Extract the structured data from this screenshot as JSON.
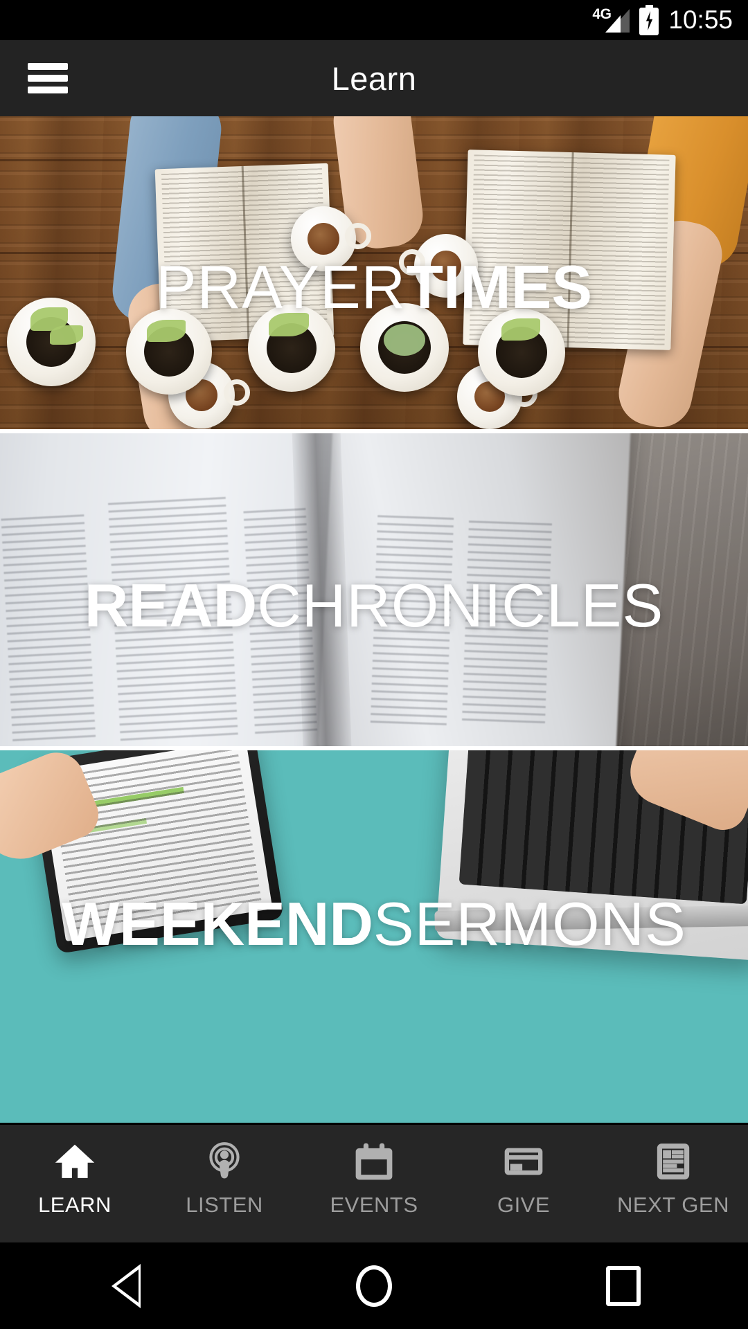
{
  "status_bar": {
    "network_label": "4G",
    "network_icon": "signal-bars-icon",
    "battery_icon": "battery-charging-icon",
    "time": "10:55"
  },
  "app_bar": {
    "menu_icon": "hamburger-menu-icon",
    "title": "Learn"
  },
  "feed": {
    "cards": [
      {
        "id": "prayer-times",
        "caption_light": "PRAYER",
        "caption_bold": "TIMES",
        "bold_first": false,
        "image_alt": "overhead view of open bibles, coffee cups and potted plants on a wooden table with people holding hands"
      },
      {
        "id": "read-chronicles",
        "caption_bold": "READ",
        "caption_light": "CHRONICLES",
        "bold_first": true,
        "image_alt": "close-up of an open bible on a grey wooden surface"
      },
      {
        "id": "weekend-sermons",
        "caption_bold": "WEEKEND",
        "caption_light": "SERMONS",
        "bold_first": true,
        "image_alt": "flatlay of hands using a tablet and laptop on a teal desk"
      }
    ]
  },
  "tab_bar": {
    "active_index": 0,
    "tabs": [
      {
        "label": "LEARN",
        "icon": "home-icon"
      },
      {
        "label": "LISTEN",
        "icon": "podcast-icon"
      },
      {
        "label": "EVENTS",
        "icon": "calendar-icon"
      },
      {
        "label": "GIVE",
        "icon": "credit-card-icon"
      },
      {
        "label": "NEXT GEN",
        "icon": "article-icon"
      }
    ]
  },
  "system_nav": {
    "back": "back-icon",
    "home": "home-circle-icon",
    "recents": "recents-square-icon"
  },
  "colors": {
    "status_bar_bg": "#000000",
    "app_bar_bg": "#232323",
    "tab_bar_bg": "#262626",
    "tab_active": "#ffffff",
    "tab_inactive": "#9d9d9d",
    "teal_accent": "#5bbcba",
    "caption_text": "#ffffff"
  }
}
